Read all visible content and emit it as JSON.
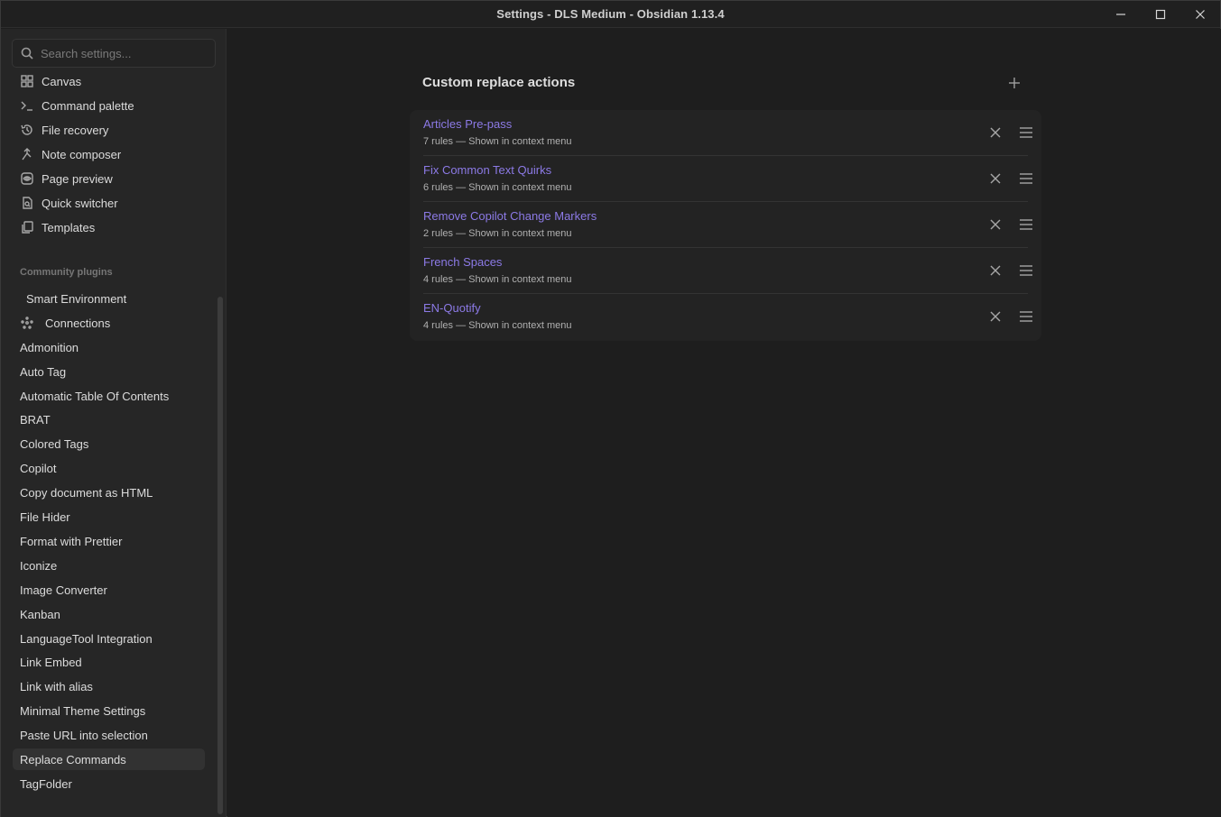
{
  "window": {
    "title": "Settings - DLS Medium - Obsidian 1.13.4"
  },
  "sidebar": {
    "search_placeholder": "Search settings...",
    "core_items": [
      {
        "label": "Canvas",
        "icon": "grid-icon"
      },
      {
        "label": "Command palette",
        "icon": "terminal-icon"
      },
      {
        "label": "File recovery",
        "icon": "history-icon"
      },
      {
        "label": "Note composer",
        "icon": "merge-icon"
      },
      {
        "label": "Page preview",
        "icon": "eye-icon"
      },
      {
        "label": "Quick switcher",
        "icon": "file-search-icon"
      },
      {
        "label": "Templates",
        "icon": "copy-icon"
      }
    ],
    "community_label": "Community plugins",
    "community_items": [
      {
        "label": "Smart Environment"
      },
      {
        "label": "Connections",
        "icon": "connections-icon"
      },
      {
        "label": "Admonition"
      },
      {
        "label": "Auto Tag"
      },
      {
        "label": "Automatic Table Of Contents"
      },
      {
        "label": "BRAT"
      },
      {
        "label": "Colored Tags"
      },
      {
        "label": "Copilot"
      },
      {
        "label": "Copy document as HTML"
      },
      {
        "label": "File Hider"
      },
      {
        "label": "Format with Prettier"
      },
      {
        "label": "Iconize"
      },
      {
        "label": "Image Converter"
      },
      {
        "label": "Kanban"
      },
      {
        "label": "LanguageTool Integration"
      },
      {
        "label": "Link Embed"
      },
      {
        "label": "Link with alias"
      },
      {
        "label": "Minimal Theme Settings"
      },
      {
        "label": "Paste URL into selection"
      },
      {
        "label": "Replace Commands",
        "active": true
      },
      {
        "label": "TagFolder"
      }
    ]
  },
  "main": {
    "section_title": "Custom replace actions",
    "actions": [
      {
        "name": "Articles Pre-pass",
        "desc": "7 rules — Shown in context menu"
      },
      {
        "name": "Fix Common Text Quirks",
        "desc": "6 rules — Shown in context menu"
      },
      {
        "name": "Remove Copilot Change Markers",
        "desc": "2 rules — Shown in context menu"
      },
      {
        "name": "French Spaces",
        "desc": "4 rules — Shown in context menu"
      },
      {
        "name": "EN-Quotify",
        "desc": "4 rules — Shown in context menu"
      }
    ]
  },
  "colors": {
    "accent": "#8c7ae6",
    "background": "#1e1e1e",
    "sidebar": "#262626"
  }
}
